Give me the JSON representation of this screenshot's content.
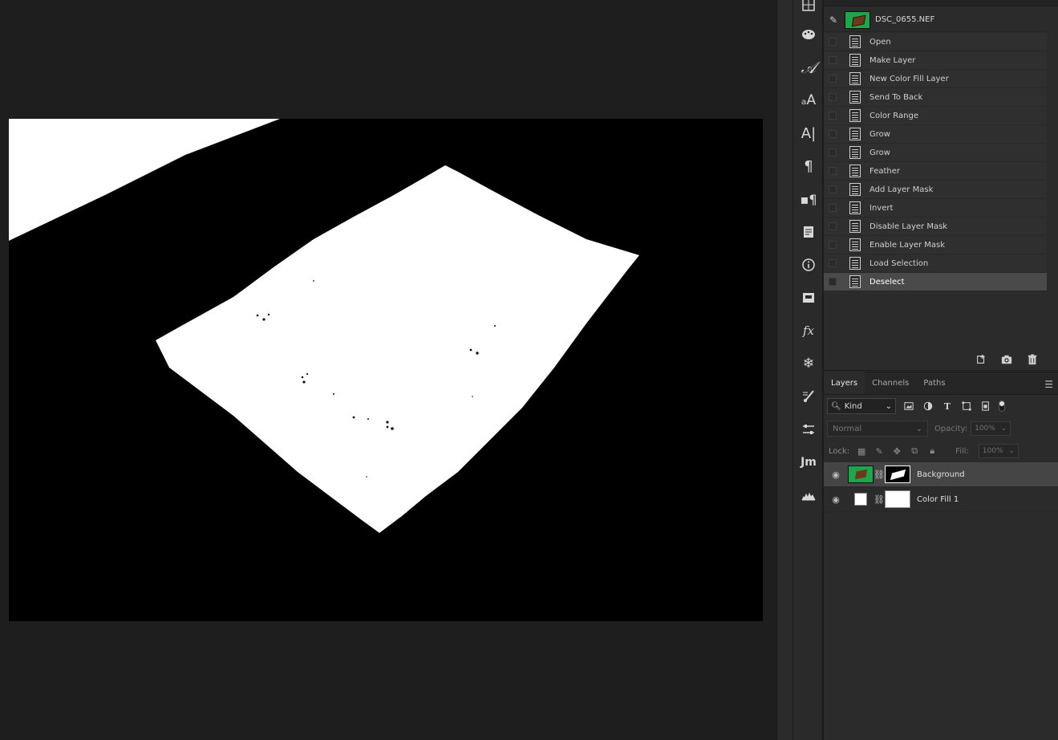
{
  "canvas": {
    "description_colors": {
      "background": "#000000",
      "foreground": "#ffffff"
    }
  },
  "tools": [
    "grid-icon",
    "palette-icon",
    "character-icon",
    "character-style-icon",
    "glyphs-icon",
    "paragraph-icon",
    "paragraph-style-icon",
    "notes-icon",
    "info-icon",
    "3d-icon",
    "fx-icon",
    "plugin-icon",
    "brush-settings-icon",
    "adjustments-icon",
    "jm-icon",
    "histogram-icon"
  ],
  "tool_labels": {
    "jm": "Jm"
  },
  "history": {
    "snapshot_name": "DSC_0655.NEF",
    "items": [
      "Open",
      "Make Layer",
      "New Color Fill Layer",
      "Send To Back",
      "Color Range",
      "Grow",
      "Grow",
      "Feather",
      "Add Layer Mask",
      "Invert",
      "Disable Layer Mask",
      "Enable Layer Mask",
      "Load Selection",
      "Deselect"
    ],
    "selected_index": 13
  },
  "layers_panel": {
    "tabs": [
      "Layers",
      "Channels",
      "Paths"
    ],
    "active_tab": "Layers",
    "filter_kind": "Kind",
    "blend_mode": "Normal",
    "opacity_label": "Opacity:",
    "opacity_value": "100%",
    "lock_label": "Lock:",
    "fill_label": "Fill:",
    "fill_value": "100%",
    "layers": [
      {
        "name": "Background",
        "selected": true
      },
      {
        "name": "Color Fill 1",
        "selected": false
      }
    ]
  },
  "colors": {
    "thumb_green": "#1fa64a",
    "selected_row": "#454545",
    "panel_bg": "#2b2b2b"
  }
}
